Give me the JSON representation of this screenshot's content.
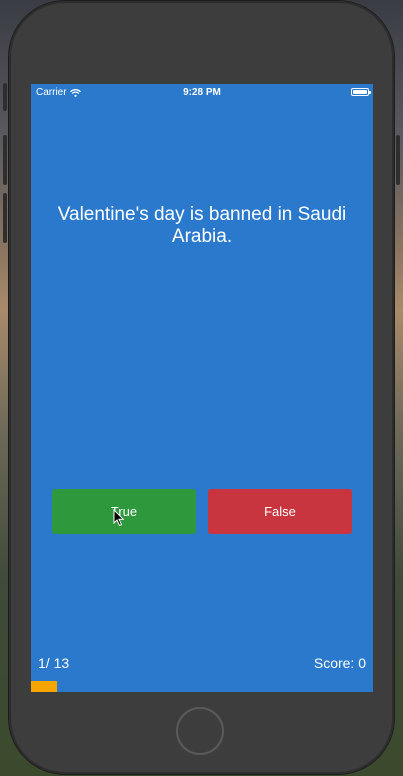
{
  "status_bar": {
    "carrier": "Carrier",
    "time": "9:28 PM"
  },
  "quiz": {
    "question": "Valentine's day is banned in Saudi Arabia.",
    "true_label": "True",
    "false_label": "False",
    "progress_label": "1/ 13",
    "score_label": "Score: 0",
    "progress_fraction": 0.0769
  },
  "colors": {
    "screen_background": "#2a79cc",
    "true_button": "#2e993c",
    "false_button": "#c9353e",
    "progress_bar": "#f5a400"
  },
  "icons": [
    "wifi-icon",
    "battery-icon",
    "cursor-icon",
    "home-button"
  ]
}
